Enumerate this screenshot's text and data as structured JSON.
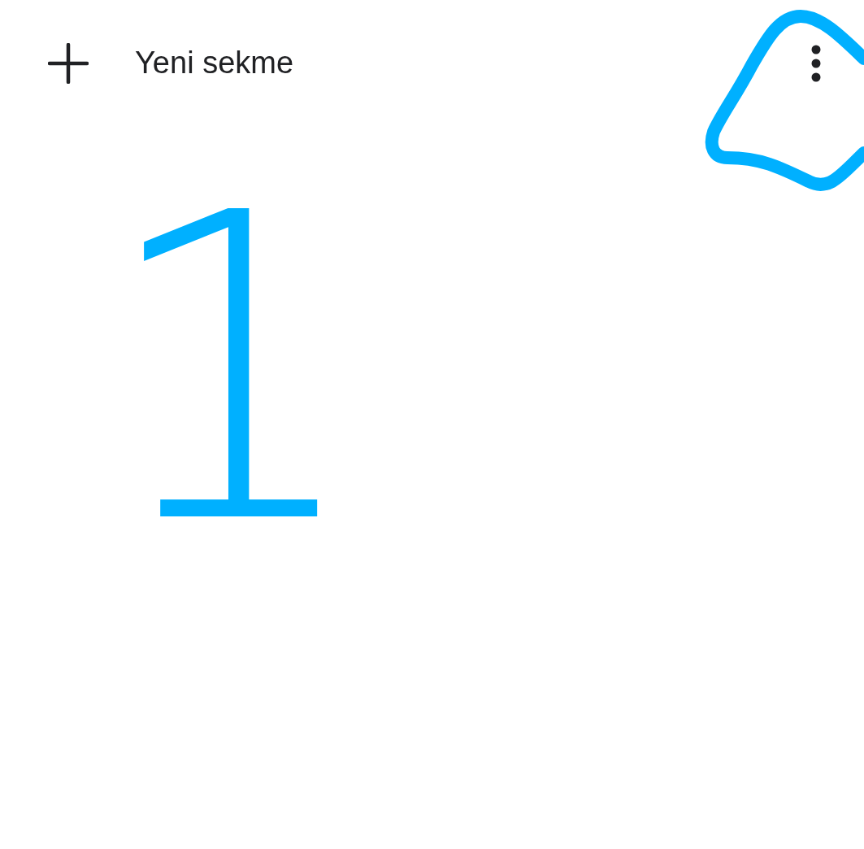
{
  "app_bar": {
    "title": "Yeni sekme"
  },
  "annotations": [
    {
      "kind": "text",
      "text": "1"
    },
    {
      "kind": "circle"
    }
  ]
}
